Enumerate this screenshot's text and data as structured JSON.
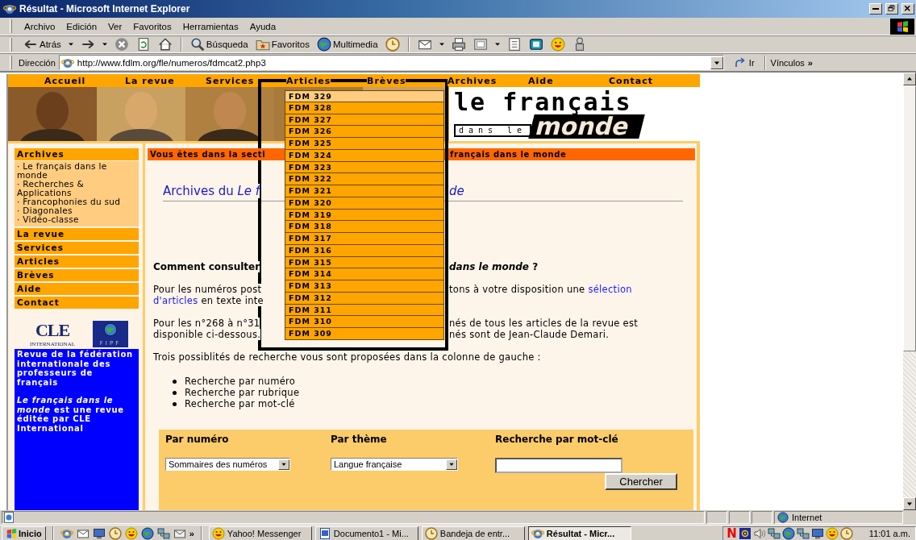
{
  "window": {
    "title": "Résultat - Microsoft Internet Explorer"
  },
  "menu_bar": [
    "Archivo",
    "Edición",
    "Ver",
    "Favoritos",
    "Herramientas",
    "Ayuda"
  ],
  "toolbar": [
    {
      "kind": "back",
      "label": "Atrás",
      "caret": true
    },
    {
      "kind": "forward",
      "caret": true
    },
    {
      "kind": "stop"
    },
    {
      "kind": "refresh"
    },
    {
      "kind": "home"
    },
    {
      "kind": "sep"
    },
    {
      "kind": "search",
      "label": "Búsqueda"
    },
    {
      "kind": "favorites",
      "label": "Favoritos"
    },
    {
      "kind": "media",
      "label": "Multimedia"
    },
    {
      "kind": "history"
    },
    {
      "kind": "sep"
    },
    {
      "kind": "mail",
      "caret": true
    },
    {
      "kind": "print"
    },
    {
      "kind": "edit",
      "caret": true
    },
    {
      "kind": "discuss"
    },
    {
      "kind": "messenger"
    },
    {
      "kind": "smiley"
    },
    {
      "kind": "tool"
    }
  ],
  "address_bar": {
    "label": "Dirección",
    "url": "http://www.fdlm.org/fle/numeros/fdmcat2.php3",
    "go": "Ir",
    "links": "Vínculos",
    "more": "»"
  },
  "page": {
    "nav": [
      "Accueil",
      "La revue",
      "Services",
      "Articles",
      "Brèves",
      "Archives",
      "Aide",
      "Contact"
    ],
    "logo": {
      "line_1": "le français",
      "line_2": "dans le",
      "line_3": "monde"
    },
    "sidebar": {
      "sections": [
        {
          "title": "Archives",
          "items": [
            "· Le français dans le monde",
            "· Recherches & Applications",
            "· Francophonies du sud",
            "· Diagonales",
            "· Vidéo-classe"
          ]
        },
        {
          "title": "La revue"
        },
        {
          "title": "Services"
        },
        {
          "title": "Articles"
        },
        {
          "title": "Brèves"
        },
        {
          "title": "Aide"
        },
        {
          "title": "Contact"
        }
      ],
      "partners": {
        "cle": "CLE",
        "cle_sub": "INTERNATIONAL",
        "fipf": "FIPF"
      },
      "about": [
        "Revue de la fédération internationale des professeurs de français",
        "*Le français dans le monde* est une revue éditée par CLE International"
      ]
    },
    "blocks": [
      {
        "kind": "section",
        "lines": [
          {
            "left": [
              {
                "text": "Vous êtes dans la secti"
              }
            ],
            "right": [
              {
                "text": "français dans le monde"
              }
            ]
          }
        ]
      },
      {
        "kind": "heading",
        "lines": [
          {
            "left": [
              {
                "text": "Archives du "
              },
              {
                "text": "Le f",
                "italic": true
              }
            ],
            "right": [
              {
                "text": "de",
                "italic": true
              }
            ]
          }
        ]
      },
      {
        "kind": "bold",
        "lines": [
          {
            "left": [
              {
                "text": "Comment consulter"
              }
            ],
            "right": [
              {
                "text": "dans le monde",
                "italic": true
              },
              {
                "text": " ?"
              }
            ]
          }
        ]
      },
      {
        "kind": "text",
        "lines": [
          {
            "left": [
              {
                "text": "Pour les numéros post"
              }
            ],
            "right": [
              {
                "text": "tons à votre disposition une "
              },
              {
                "text": "sélection",
                "link": true
              }
            ]
          },
          {
            "left": [
              {
                "text": "d'articles",
                "link": true
              },
              {
                "text": " en texte inte"
              }
            ]
          }
        ]
      },
      {
        "kind": "text",
        "lines": [
          {
            "left": [
              {
                "text": "Pour les n°268 à n°31"
              }
            ],
            "right": [
              {
                "text": "nés de tous les articles de la revue est"
              }
            ]
          },
          {
            "left": [
              {
                "text": "disponible ci-dessous."
              }
            ],
            "right": [
              {
                "text": "nés sont de Jean-Claude Demari."
              }
            ]
          }
        ]
      }
    ],
    "intro": "Trois possiblités de recherche vous sont proposées dans la colonne de gauche :",
    "bullets": [
      "Recherche par numéro",
      "Recherche par rubrique",
      "Recherche par mot-clé"
    ],
    "search_panel": {
      "columns": [
        {
          "title": "Par numéro",
          "kind": "select",
          "value": "Sommaires des numéros"
        },
        {
          "title": "Par thème",
          "kind": "select",
          "value": "Langue française"
        },
        {
          "title": "Recherche par mot-clé",
          "kind": "text",
          "button": "Chercher"
        }
      ]
    },
    "dropdown": {
      "items": [
        {
          "label": "FDM 329",
          "selected": true
        },
        {
          "label": "FDM 328",
          "selected": false
        },
        {
          "label": "FDM 327",
          "selected": false
        },
        {
          "label": "FDM 326",
          "selected": false
        },
        {
          "label": "FDM 325",
          "selected": false
        },
        {
          "label": "FDM 324",
          "selected": false
        },
        {
          "label": "FDM 323",
          "selected": false
        },
        {
          "label": "FDM 322",
          "selected": false
        },
        {
          "label": "FDM 321",
          "selected": false
        },
        {
          "label": "FDM 320",
          "selected": false
        },
        {
          "label": "FDM 319",
          "selected": false
        },
        {
          "label": "FDM 318",
          "selected": false
        },
        {
          "label": "FDM 317",
          "selected": false
        },
        {
          "label": "FDM 316",
          "selected": false
        },
        {
          "label": "FDM 315",
          "selected": false
        },
        {
          "label": "FDM 314",
          "selected": false
        },
        {
          "label": "FDM 313",
          "selected": false
        },
        {
          "label": "FDM 312",
          "selected": false
        },
        {
          "label": "FDM 311",
          "selected": false
        },
        {
          "label": "FDM 310",
          "selected": false
        },
        {
          "label": "FDM 309",
          "selected": false
        }
      ]
    }
  },
  "status_bar": {
    "zone": "Internet"
  },
  "taskbar": {
    "start": "Inicio",
    "quick_launch": [
      {
        "kind": "browser"
      },
      {
        "kind": "mail"
      },
      {
        "kind": "desktop"
      },
      {
        "kind": "history"
      },
      {
        "kind": "smiley"
      },
      {
        "kind": "media"
      },
      {
        "kind": "network"
      },
      {
        "kind": "envelope"
      }
    ],
    "more": "»",
    "tasks": [
      {
        "kind": "smiley",
        "label": "Yahoo! Messenger",
        "selected": false
      },
      {
        "kind": "document",
        "label": "Documento1 - Mi...",
        "selected": false
      },
      {
        "kind": "history",
        "label": "Bandeja de entr...",
        "selected": false
      },
      {
        "kind": "browser",
        "label": "Résultat - Micr...",
        "selected": true
      }
    ],
    "tray": [
      {
        "kind": "letter",
        "text": "N"
      },
      {
        "kind": "radio"
      },
      {
        "kind": "speaker"
      },
      {
        "kind": "network"
      },
      {
        "kind": "media"
      },
      {
        "kind": "network"
      },
      {
        "kind": "desktop"
      },
      {
        "kind": "smiley"
      },
      {
        "kind": "history"
      }
    ],
    "clock": "11:01 a.m."
  }
}
